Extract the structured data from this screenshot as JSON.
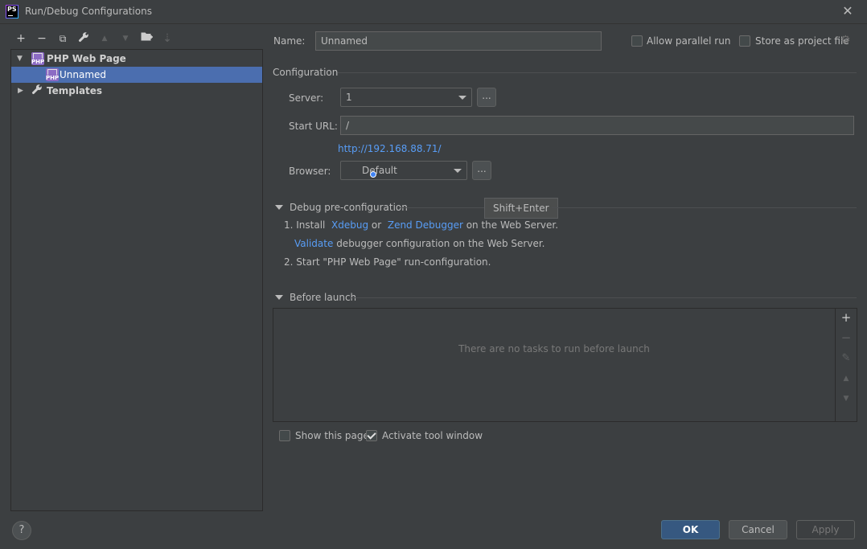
{
  "window": {
    "title": "Run/Debug Configurations",
    "logo_text": "PS"
  },
  "toolbar": {
    "add": "+",
    "remove": "−",
    "copy": "⧉",
    "edit_defaults": "🔧",
    "move_up": "▲",
    "move_down": "▼",
    "new_folder": "📁",
    "sort": "⇣"
  },
  "tree": {
    "group_label": "PHP Web Page",
    "selected_item": "Unnamed",
    "templates_label": "Templates"
  },
  "form": {
    "name_label": "Name:",
    "name_value": "Unnamed",
    "allow_parallel_label": "Allow parallel run",
    "store_as_project_label": "Store as project file",
    "configuration_header": "Configuration",
    "server_label": "Server:",
    "server_value": "1",
    "dots": "...",
    "start_url_label": "Start URL:",
    "start_url_value": "/",
    "resolved_url": "http://192.168.88.71/",
    "browser_label": "Browser:",
    "browser_value": "Default"
  },
  "debug": {
    "header": "Debug pre-configuration",
    "step1_prefix": "1. Install",
    "xdebug": "Xdebug",
    "or": "or",
    "zend": "Zend Debugger",
    "step1_suffix": "on the Web Server.",
    "validate": "Validate",
    "validate_suffix": "debugger configuration on the Web Server.",
    "step2": "2. Start \"PHP Web Page\" run-configuration."
  },
  "tooltip": {
    "text": "Shift+Enter"
  },
  "before_launch": {
    "header": "Before launch",
    "empty_text": "There are no tasks to run before launch",
    "side_add": "+",
    "side_remove": "−",
    "side_edit": "✎",
    "side_up": "▲",
    "side_down": "▼"
  },
  "options": {
    "show_page_label": "Show this page",
    "show_page_checked": false,
    "activate_tool_label": "Activate tool window",
    "activate_tool_checked": true
  },
  "footer": {
    "help": "?",
    "ok": "OK",
    "cancel": "Cancel",
    "apply": "Apply"
  },
  "colors": {
    "background": "#3c3f41",
    "selection": "#4b6eaf",
    "link": "#589df6",
    "primary_button": "#365880"
  }
}
